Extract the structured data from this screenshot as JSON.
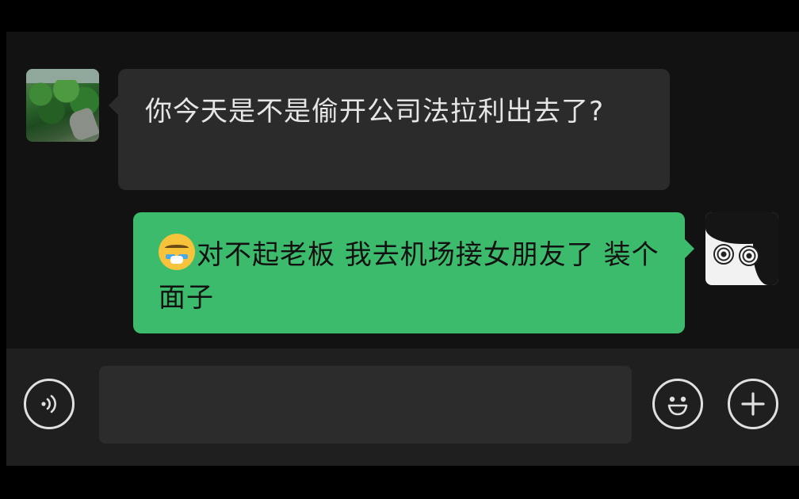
{
  "conversation": {
    "messages": [
      {
        "direction": "incoming",
        "text": "你今天是不是偷开公司法拉利出去了?"
      },
      {
        "direction": "outgoing",
        "emoji": "crying-face-emoji",
        "text": "对不起老板 我去机场接女朋友了 装个面子"
      }
    ]
  },
  "input_bar": {
    "voice_icon": "voice-icon",
    "text_value": "",
    "emoji_icon": "smiley-icon",
    "plus_icon": "plus-icon"
  },
  "colors": {
    "background": "#000000",
    "chat_background": "#121212",
    "incoming_bubble": "#2b2b2b",
    "outgoing_bubble": "#3dbb6c",
    "input_bar": "#1f1f1f"
  }
}
